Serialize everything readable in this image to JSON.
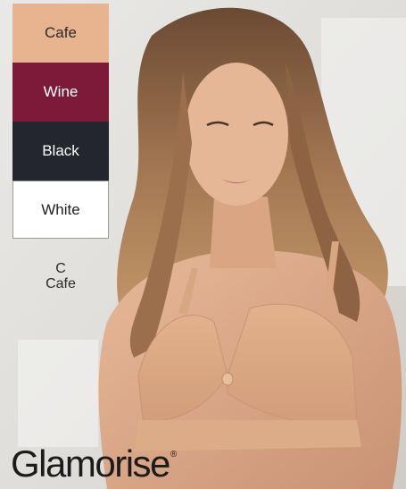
{
  "swatches": [
    {
      "label": "Cafe",
      "color": "#e8b48f"
    },
    {
      "label": "Wine",
      "color": "#7d1a3a"
    },
    {
      "label": "Black",
      "color": "#23262c"
    },
    {
      "label": "White",
      "color": "#ffffff"
    }
  ],
  "selection": {
    "size": "C",
    "color": "Cafe"
  },
  "brand": {
    "name": "Glamorise",
    "mark": "®"
  },
  "photo": {
    "subject": "model-wearing-cafe-bra"
  }
}
